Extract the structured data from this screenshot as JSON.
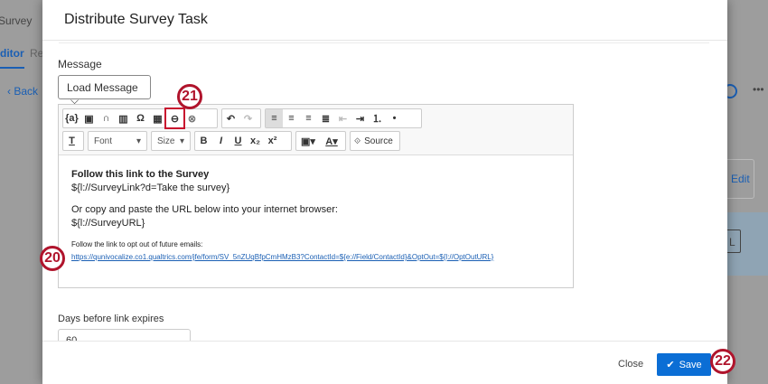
{
  "background": {
    "crumb": "Survey",
    "tab_editor": "ditor",
    "tab_reports": "Re",
    "back": "Back",
    "more": "•••",
    "edit": "Edit",
    "button_l": "L"
  },
  "modal": {
    "title": "Distribute Survey Task",
    "message_label": "Message",
    "load_message": "Load Message",
    "toolbar": {
      "font": "Font",
      "size": "Size",
      "source": "Source"
    },
    "content": {
      "heading": "Follow this link to the Survey",
      "survey_link": "${l://SurveyLink?d=Take the survey}",
      "copy_text": "Or copy and paste the URL below into your internet browser:",
      "survey_url": "${l://SurveyURL}",
      "optout_text": "Follow the link to opt out of future emails:",
      "optout_url": "https://qunivocalize.co1.qualtrics.com/jfe/form/SV_5nZUqBfpCmHMzB3?ContactId=${e://Field/ContactId}&OptOut=${l://OptOutURL}"
    },
    "days_label": "Days before link expires",
    "days_value": "60",
    "close": "Close",
    "save": "Save"
  },
  "annotations": {
    "a20": "20",
    "a21": "21",
    "a22": "22"
  },
  "colors": {
    "accent": "#0b6ed5",
    "annotation": "#b0142c"
  }
}
